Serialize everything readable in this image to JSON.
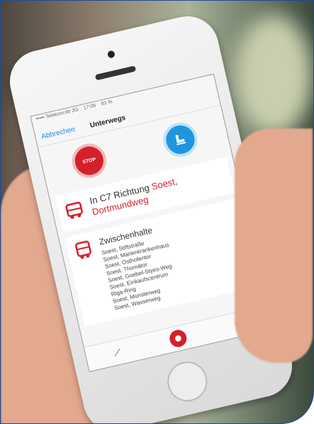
{
  "status_bar": {
    "carrier": "••••• Telekom.de  3G",
    "time": "17:06",
    "battery": "81 %"
  },
  "nav": {
    "back_label": "Abbrechen",
    "title": "Unterwegs"
  },
  "stop_button_label": "STOP",
  "direction": {
    "line_prefix": "In C7 Richtung",
    "destination": "Soest, Dortmundweg"
  },
  "stops": {
    "title": "Zwischenhalte",
    "items": [
      "Soest, Stiftstraße",
      "Soest, Marienkrankenhaus",
      "Soest, Osthofentor",
      "Soest, Thomätor",
      "Soest, Goebel-Styes-Weg",
      "Soest, Einkaufscentrum",
      "Riga-Ring",
      "Soest, Münsterweg",
      "Soest, Wasserweg"
    ]
  },
  "colors": {
    "brand_red": "#d4202a",
    "accent_blue": "#1f95e0",
    "link_blue": "#1a8be8"
  }
}
